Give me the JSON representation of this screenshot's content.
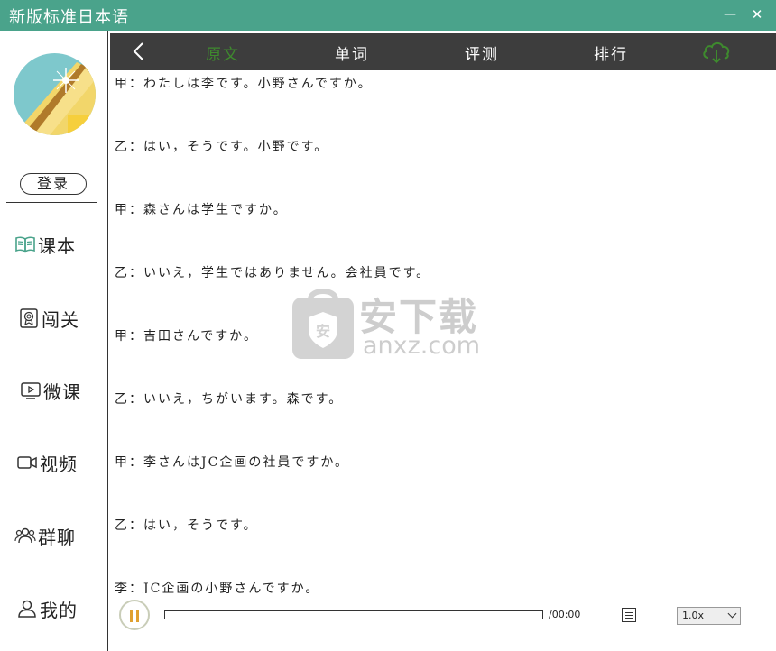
{
  "app": {
    "title": "新版标准日本语"
  },
  "window_controls": {
    "minimize": "—",
    "close": "✕"
  },
  "sidebar": {
    "login_label": "登录",
    "items": [
      {
        "label": "课本",
        "icon": "book-icon"
      },
      {
        "label": "闯关",
        "icon": "medal-icon"
      },
      {
        "label": "微课",
        "icon": "video-lesson-icon"
      },
      {
        "label": "视频",
        "icon": "camera-icon"
      },
      {
        "label": "群聊",
        "icon": "group-icon"
      },
      {
        "label": "我的",
        "icon": "user-icon"
      }
    ]
  },
  "tabs": {
    "items": [
      {
        "label": "原文",
        "active": true
      },
      {
        "label": "单词",
        "active": false
      },
      {
        "label": "评测",
        "active": false
      },
      {
        "label": "排行",
        "active": false
      }
    ],
    "back_icon": "back-arrow-icon",
    "cloud_icon": "cloud-download-icon"
  },
  "content": {
    "lines": [
      "甲：わたしは李です。小野さんですか。",
      "乙：はい，そうです。小野です。",
      "甲：森さんは学生ですか。",
      "乙：いいえ，学生ではありません。会社員です。",
      "甲：吉田さんですか。",
      "乙：いいえ，ちがいます。森です。",
      "甲：李さんはJC企画の社員ですか。",
      "乙：はい，そうです。",
      "李：JC企画の小野さんですか。"
    ]
  },
  "watermark": {
    "text_cn": "安下载",
    "text_url": "anxz.com"
  },
  "player": {
    "time": "/00:00",
    "progress": 0,
    "speed": "1.0x",
    "pause_icon": "pause-icon",
    "list_icon": "subtitle-icon"
  },
  "colors": {
    "titlebar": "#4aa38b",
    "tabbar": "#3d3d3d",
    "active_tab": "#3e8a2e"
  }
}
